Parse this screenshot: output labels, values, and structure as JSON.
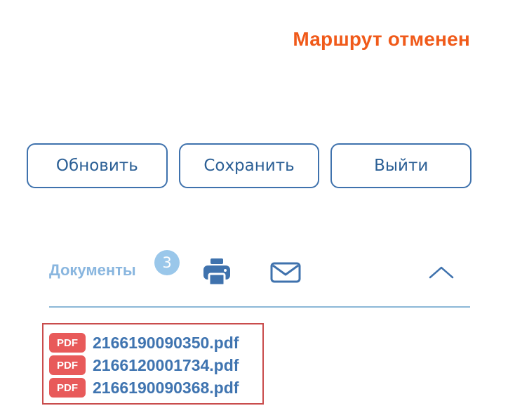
{
  "status": {
    "text": "Маршрут отменен",
    "color": "#f05a1a"
  },
  "actions": {
    "refresh_label": "Обновить",
    "save_label": "Сохранить",
    "exit_label": "Выйти"
  },
  "documents": {
    "title": "Документы",
    "count": "3",
    "icons": {
      "print": "print-icon",
      "mail": "mail-icon",
      "toggle": "chevron-up-icon"
    },
    "items": [
      {
        "type": "PDF",
        "name": "2166190090350.pdf"
      },
      {
        "type": "PDF",
        "name": "2166120001734.pdf"
      },
      {
        "type": "PDF",
        "name": "2166190090368.pdf"
      }
    ]
  },
  "colors": {
    "primary": "#3f72ad",
    "accent": "#f05a1a",
    "pdf_badge": "#e85a5a"
  }
}
